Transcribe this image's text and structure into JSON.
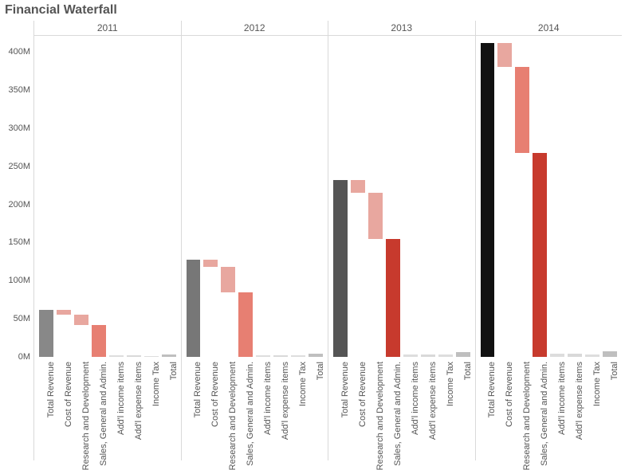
{
  "title": "Financial Waterfall",
  "y_ticks": [
    "0M",
    "50M",
    "100M",
    "150M",
    "200M",
    "250M",
    "300M",
    "350M",
    "400M"
  ],
  "categories": [
    "Total Revenue",
    "Cost of Revenue",
    "Research and Development",
    "Sales, General and Admin.",
    "Add'l income items",
    "Add'l expense items",
    "Income Tax",
    "Total"
  ],
  "colors": {
    "TotalRevenue_2011": "#888",
    "TotalRevenue_2012": "#777",
    "TotalRevenue_2013": "#555",
    "TotalRevenue_2014": "#111",
    "neg_light": "#e8a79f",
    "neg_mid": "#e77f72",
    "neg_dark": "#c73a2d",
    "total": "#bfbfbf",
    "pos": "#ddd",
    "small_neg": "#d9d9d9"
  },
  "chart_data": {
    "type": "bar",
    "title": "Financial Waterfall",
    "ylabel": "",
    "xlabel": "",
    "ylim": [
      0,
      420
    ],
    "panels": [
      "2011",
      "2012",
      "2013",
      "2014"
    ],
    "categories": [
      "Total Revenue",
      "Cost of Revenue",
      "Research and Development",
      "Sales, General and Admin.",
      "Add'l income items",
      "Add'l expense items",
      "Income Tax",
      "Total"
    ],
    "series": [
      {
        "name": "2011",
        "bars": [
          {
            "cat": "Total Revenue",
            "start": 0,
            "end": 62,
            "color": "#888"
          },
          {
            "cat": "Cost of Revenue",
            "start": 62,
            "end": 55,
            "color": "#e8a79f"
          },
          {
            "cat": "Research and Development",
            "start": 55,
            "end": 42,
            "color": "#e8a79f"
          },
          {
            "cat": "Sales, General and Admin.",
            "start": 42,
            "end": 0,
            "color": "#e77f72"
          },
          {
            "cat": "Add'l income items",
            "start": 0,
            "end": 2,
            "color": "#ddd"
          },
          {
            "cat": "Add'l expense items",
            "start": 2,
            "end": 0,
            "color": "#d9d9d9"
          },
          {
            "cat": "Income Tax",
            "start": 0,
            "end": 1,
            "color": "#ddd"
          },
          {
            "cat": "Total",
            "start": 0,
            "end": 3,
            "color": "#bfbfbf"
          }
        ]
      },
      {
        "name": "2012",
        "bars": [
          {
            "cat": "Total Revenue",
            "start": 0,
            "end": 128,
            "color": "#777"
          },
          {
            "cat": "Cost of Revenue",
            "start": 128,
            "end": 118,
            "color": "#e8a79f"
          },
          {
            "cat": "Research and Development",
            "start": 118,
            "end": 85,
            "color": "#e8a79f"
          },
          {
            "cat": "Sales, General and Admin.",
            "start": 85,
            "end": 0,
            "color": "#e77f72"
          },
          {
            "cat": "Add'l income items",
            "start": 0,
            "end": 2,
            "color": "#ddd"
          },
          {
            "cat": "Add'l expense items",
            "start": 2,
            "end": 0,
            "color": "#d9d9d9"
          },
          {
            "cat": "Income Tax",
            "start": 0,
            "end": 2,
            "color": "#ddd"
          },
          {
            "cat": "Total",
            "start": 0,
            "end": 4,
            "color": "#bfbfbf"
          }
        ]
      },
      {
        "name": "2013",
        "bars": [
          {
            "cat": "Total Revenue",
            "start": 0,
            "end": 232,
            "color": "#555"
          },
          {
            "cat": "Cost of Revenue",
            "start": 232,
            "end": 215,
            "color": "#e8a79f"
          },
          {
            "cat": "Research and Development",
            "start": 215,
            "end": 155,
            "color": "#e8a79f"
          },
          {
            "cat": "Sales, General and Admin.",
            "start": 155,
            "end": 0,
            "color": "#c73a2d"
          },
          {
            "cat": "Add'l income items",
            "start": 0,
            "end": 3,
            "color": "#ddd"
          },
          {
            "cat": "Add'l expense items",
            "start": 3,
            "end": 0,
            "color": "#d9d9d9"
          },
          {
            "cat": "Income Tax",
            "start": 0,
            "end": 3,
            "color": "#ddd"
          },
          {
            "cat": "Total",
            "start": 0,
            "end": 6,
            "color": "#bfbfbf"
          }
        ]
      },
      {
        "name": "2014",
        "bars": [
          {
            "cat": "Total Revenue",
            "start": 0,
            "end": 412,
            "color": "#111"
          },
          {
            "cat": "Cost of Revenue",
            "start": 412,
            "end": 380,
            "color": "#e8a79f"
          },
          {
            "cat": "Research and Development",
            "start": 380,
            "end": 268,
            "color": "#e77f72"
          },
          {
            "cat": "Sales, General and Admin.",
            "start": 268,
            "end": 0,
            "color": "#c73a2d"
          },
          {
            "cat": "Add'l income items",
            "start": 0,
            "end": 4,
            "color": "#ddd"
          },
          {
            "cat": "Add'l expense items",
            "start": 4,
            "end": 0,
            "color": "#d9d9d9"
          },
          {
            "cat": "Income Tax",
            "start": 0,
            "end": 3,
            "color": "#ddd"
          },
          {
            "cat": "Total",
            "start": 0,
            "end": 7,
            "color": "#bfbfbf"
          }
        ]
      }
    ]
  }
}
